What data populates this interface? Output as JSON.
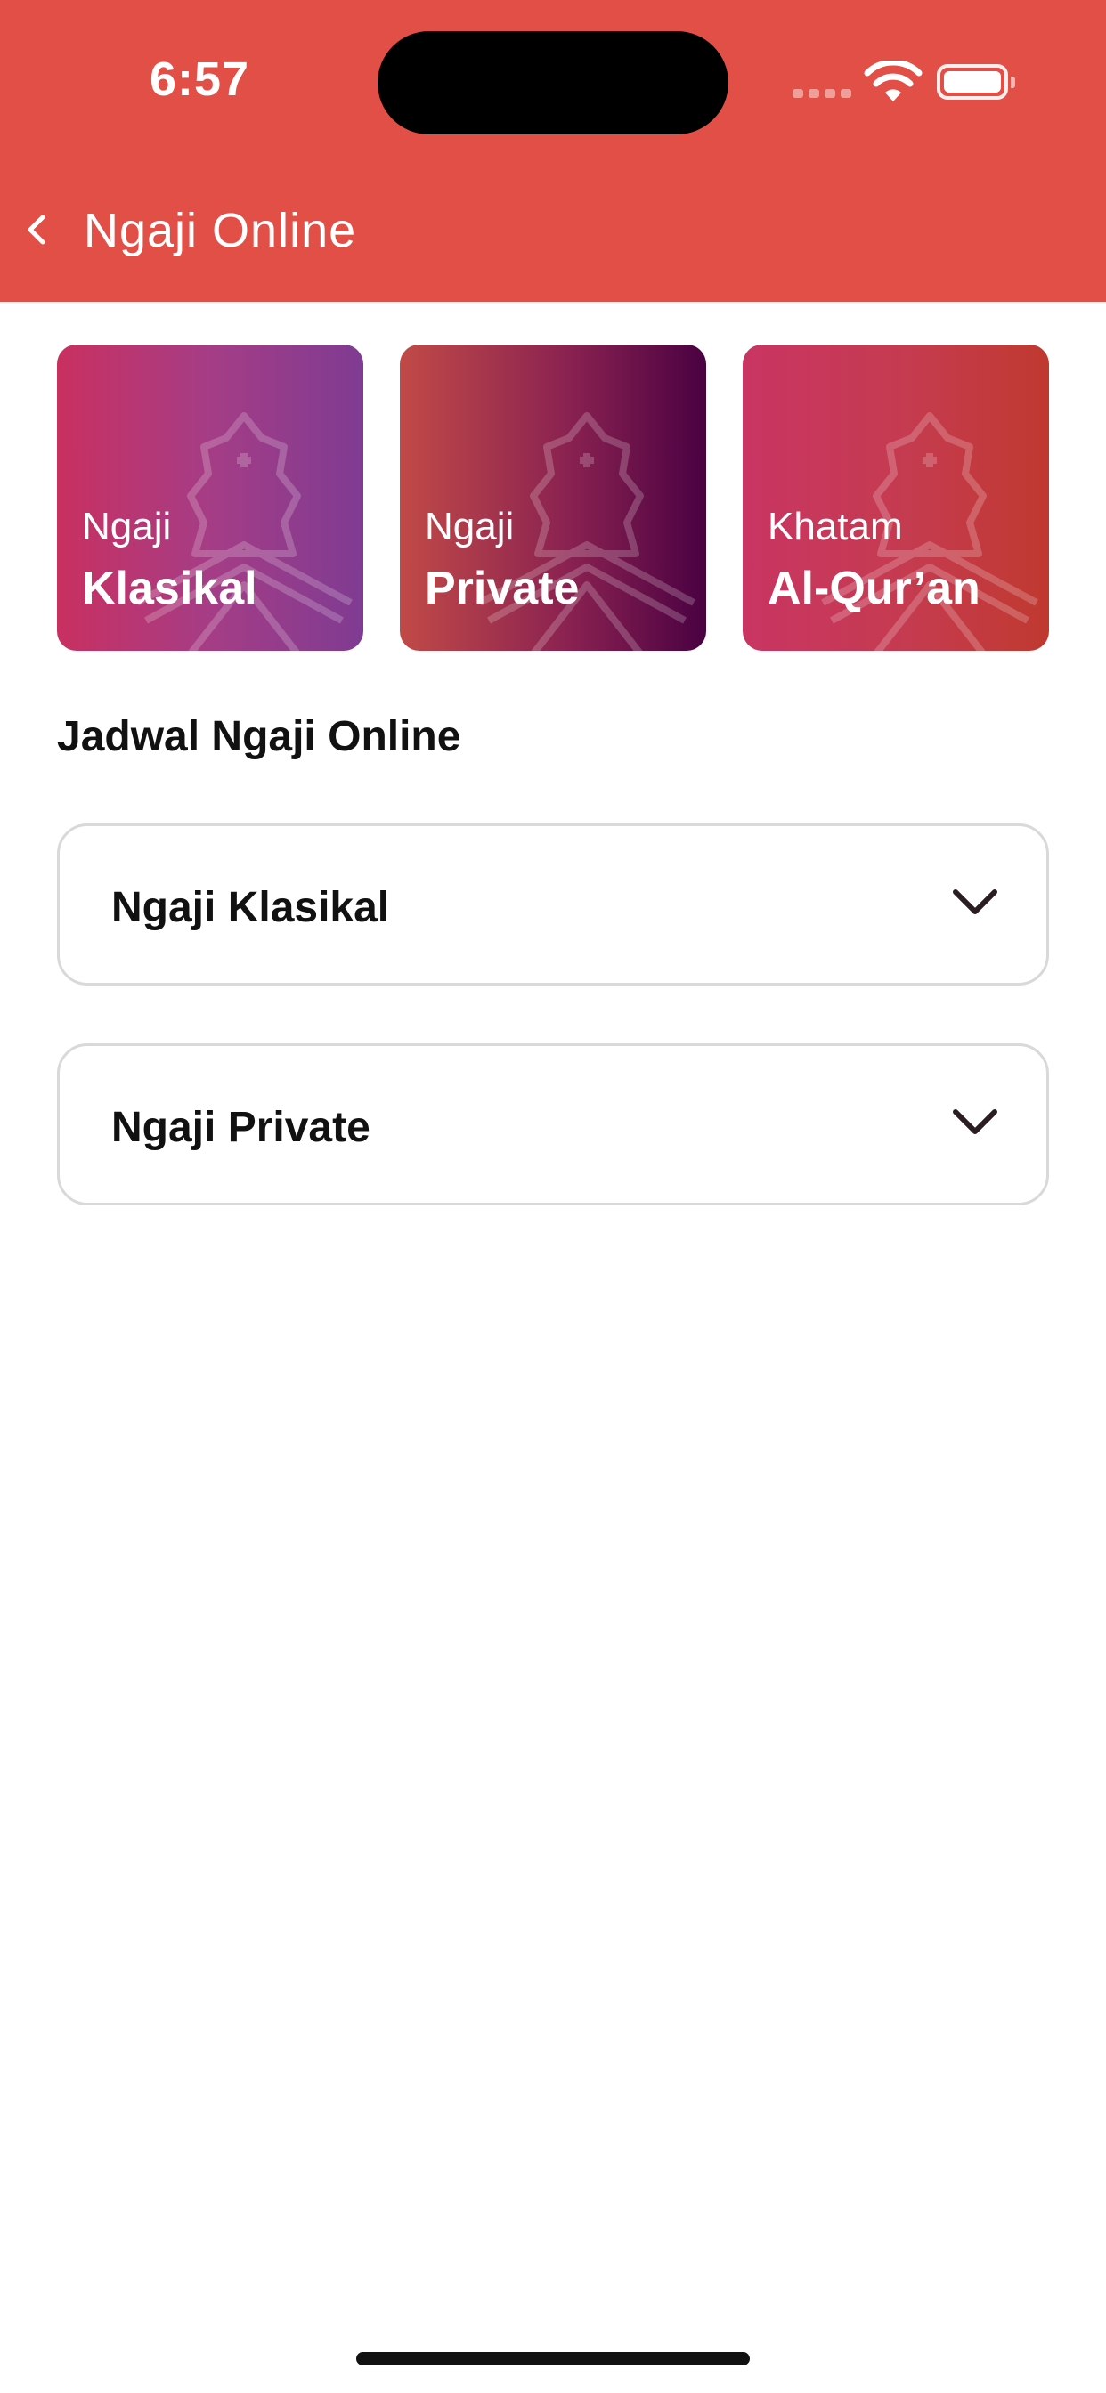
{
  "status_bar": {
    "time": "6:57"
  },
  "header": {
    "title": "Ngaji Online",
    "back_icon": "chevron-left-icon"
  },
  "cards": [
    {
      "subtitle": "Ngaji",
      "title": "Klasikal"
    },
    {
      "subtitle": "Ngaji",
      "title": "Private"
    },
    {
      "subtitle": "Khatam",
      "title": "Al-Qur’an"
    }
  ],
  "schedule": {
    "title": "Jadwal Ngaji Online",
    "items": [
      {
        "label": "Ngaji Klasikal"
      },
      {
        "label": "Ngaji Private"
      }
    ]
  },
  "colors": {
    "header": "#e24f46",
    "text": "#111111",
    "border": "#d9d9d9"
  }
}
